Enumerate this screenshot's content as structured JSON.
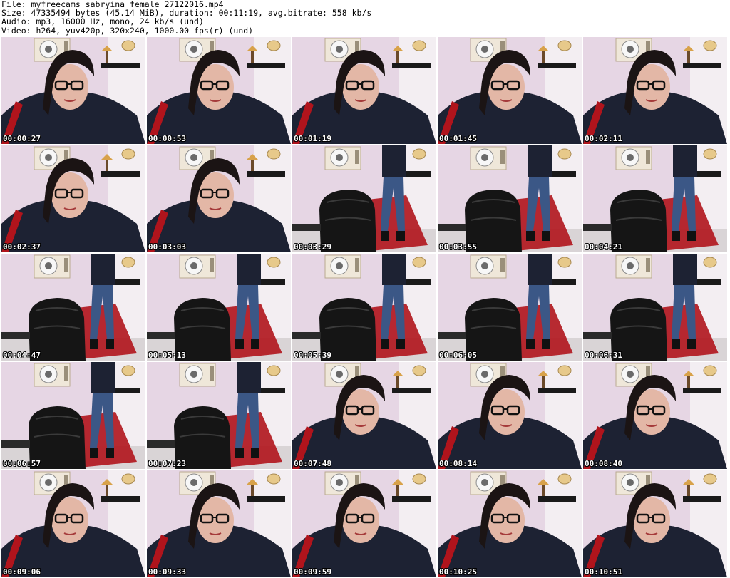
{
  "header": {
    "file": "File: myfreecams_sabryina_female_27122016.mp4",
    "size": "Size: 47335494 bytes (45.14 MiB), duration: 00:11:19, avg.bitrate: 558 kb/s",
    "audio": "Audio: mp3, 16000 Hz, mono, 24 kb/s (und)",
    "video": "Video: h264, yuv420p, 320x240, 1000.00 fps(r) (und)"
  },
  "colors": {
    "wall": "#e6d6e4",
    "wall_shade": "#d9c3d6",
    "sweater": "#1d2233",
    "hair": "#1b1414",
    "skin": "#e3b7a6",
    "jeans": "#3b5786",
    "chair": "#151515",
    "accent_red": "#b0141c",
    "shelf": "#1a1a1a"
  },
  "thumbnails": [
    {
      "time": "00:00:27",
      "scene": "closeup"
    },
    {
      "time": "00:00:53",
      "scene": "closeup"
    },
    {
      "time": "00:01:19",
      "scene": "closeup"
    },
    {
      "time": "00:01:45",
      "scene": "closeup"
    },
    {
      "time": "00:02:11",
      "scene": "closeup"
    },
    {
      "time": "00:02:37",
      "scene": "closeup"
    },
    {
      "time": "00:03:03",
      "scene": "closeup"
    },
    {
      "time": "00:03:29",
      "scene": "chair"
    },
    {
      "time": "00:03:55",
      "scene": "chair"
    },
    {
      "time": "00:04:21",
      "scene": "chair"
    },
    {
      "time": "00:04:47",
      "scene": "chair"
    },
    {
      "time": "00:05:13",
      "scene": "chair"
    },
    {
      "time": "00:05:39",
      "scene": "chair"
    },
    {
      "time": "00:06:05",
      "scene": "chair"
    },
    {
      "time": "00:06:31",
      "scene": "chair"
    },
    {
      "time": "00:06:57",
      "scene": "chair"
    },
    {
      "time": "00:07:23",
      "scene": "chair"
    },
    {
      "time": "00:07:48",
      "scene": "closeup"
    },
    {
      "time": "00:08:14",
      "scene": "closeup"
    },
    {
      "time": "00:08:40",
      "scene": "closeup"
    },
    {
      "time": "00:09:06",
      "scene": "closeup"
    },
    {
      "time": "00:09:33",
      "scene": "closeup"
    },
    {
      "time": "00:09:59",
      "scene": "closeup"
    },
    {
      "time": "00:10:25",
      "scene": "closeup"
    },
    {
      "time": "00:10:51",
      "scene": "closeup"
    }
  ]
}
